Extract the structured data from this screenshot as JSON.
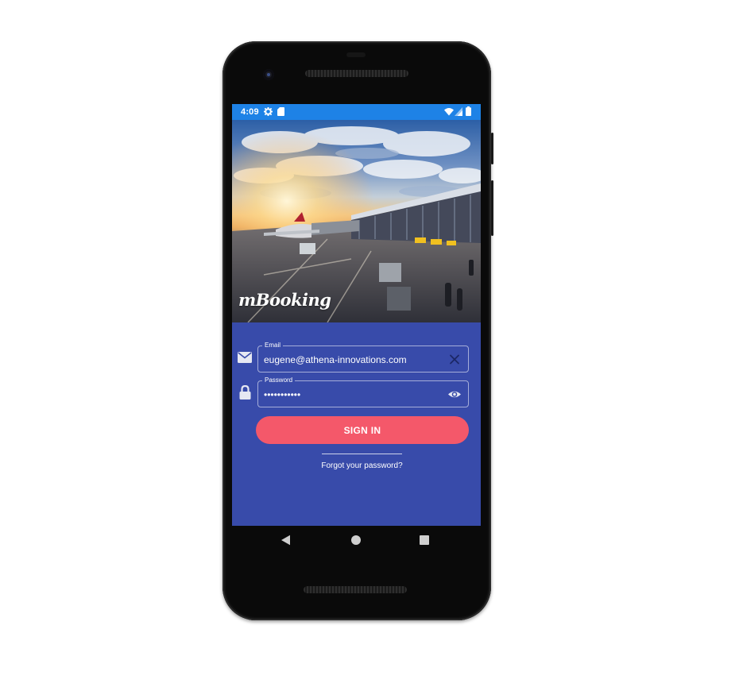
{
  "status_bar": {
    "time": "4:09",
    "left_icons": [
      "gear-icon",
      "sd-card-icon"
    ],
    "right_icons": [
      "wifi-icon",
      "signal-icon",
      "battery-icon"
    ],
    "color": "#1e82e6"
  },
  "hero": {
    "brand": "mBooking",
    "image": "airport-terminal-at-sunset"
  },
  "login_form": {
    "email": {
      "label": "Email",
      "value": "eugene@athena-innovations.com",
      "icon": "envelope-icon",
      "action_icon": "clear-icon"
    },
    "password": {
      "label": "Password",
      "value": "•••••••••••",
      "icon": "lock-icon",
      "action_icon": "eye-icon"
    },
    "sign_in_label": "SIGN IN",
    "forgot_password_label": "Forgot your password?"
  },
  "nav_bar": {
    "buttons": [
      "back-icon",
      "home-icon",
      "recents-icon"
    ]
  },
  "colors": {
    "form_background": "#384baa",
    "button": "#f4586a",
    "status_bar": "#1e82e6"
  }
}
